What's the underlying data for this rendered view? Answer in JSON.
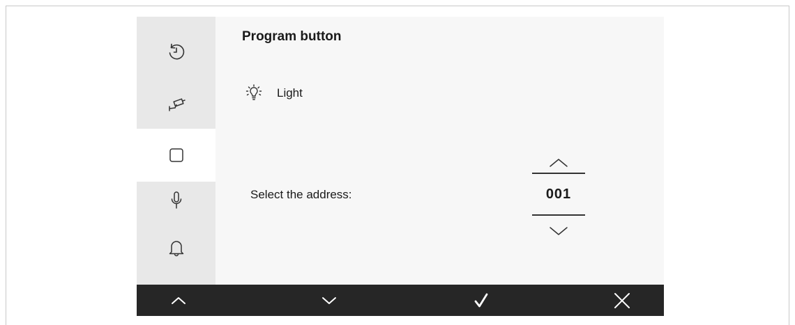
{
  "main": {
    "title": "Program button",
    "function_label": "Light",
    "address_label": "Select the address:",
    "address_value": "001"
  },
  "sidebar": {
    "items": [
      {
        "icon": "history-icon",
        "active": false
      },
      {
        "icon": "camera-icon",
        "active": false
      },
      {
        "icon": "button-square-icon",
        "active": true
      },
      {
        "icon": "microphone-icon",
        "active": false
      },
      {
        "icon": "bell-icon",
        "active": false
      }
    ]
  },
  "bottombar": {
    "buttons": [
      {
        "icon": "chevron-up-icon"
      },
      {
        "icon": "chevron-down-icon"
      },
      {
        "icon": "check-icon"
      },
      {
        "icon": "close-icon"
      }
    ]
  },
  "colors": {
    "sidebar_bg": "#e8e8e8",
    "main_bg": "#f7f7f7",
    "bottombar_bg": "#262626",
    "icon_color": "#333333"
  }
}
